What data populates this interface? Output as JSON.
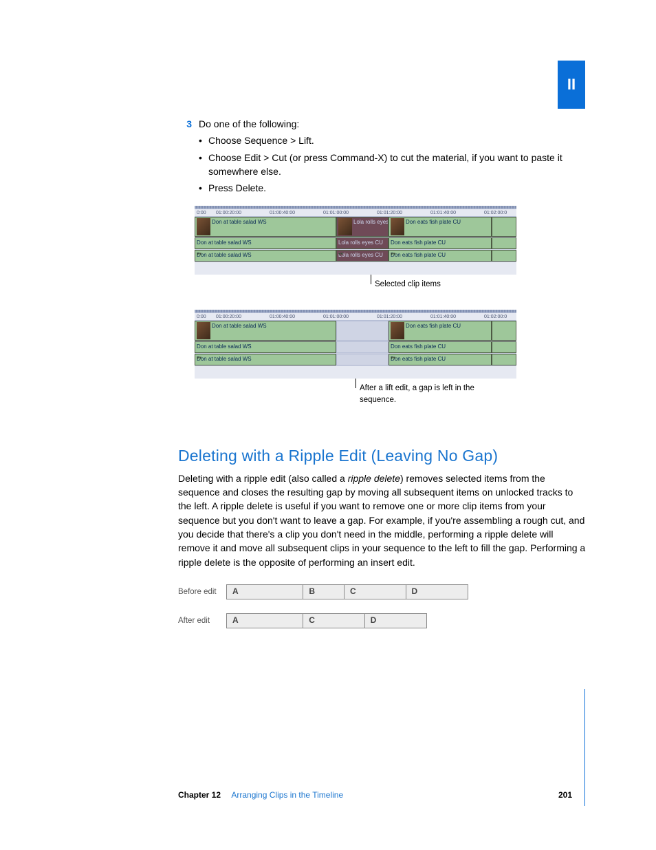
{
  "section_tab": "II",
  "step": {
    "number": "3",
    "intro": "Do one of the following:",
    "bullets": [
      "Choose Sequence > Lift.",
      "Choose Edit > Cut (or press Command-X) to cut the material, if you want to paste it somewhere else.",
      "Press Delete."
    ]
  },
  "timeline1": {
    "ticks": [
      "0:00",
      "01:00:20:00",
      "01:00:40:00",
      "01:01:00:00",
      "01:01:20:00",
      "01:01:40:00",
      "01:02:00:0"
    ],
    "clip_a": "Don at table salad WS",
    "clip_b": "Lola rolls eyes CU",
    "clip_c": "Don eats fish plate CU",
    "callout": "Selected clip items"
  },
  "timeline2": {
    "ticks": [
      "0:00",
      "01:00:20:00",
      "01:00:40:00",
      "01:01:00:00",
      "01:01:20:00",
      "01:01:40:00",
      "01:02:00:0"
    ],
    "clip_a": "Don at table salad WS",
    "clip_c": "Don eats fish plate CU",
    "callout": "After a lift edit, a gap is left in the sequence."
  },
  "heading": "Deleting with a Ripple Edit (Leaving No Gap)",
  "para_pre": "Deleting with a ripple edit (also called a ",
  "para_em": "ripple delete",
  "para_post": ") removes selected items from the sequence and closes the resulting gap by moving all subsequent items on unlocked tracks to the left. A ripple delete is useful if you want to remove one or more clip items from your sequence but you don't want to leave a gap. For example, if you're assembling a rough cut, and you decide that there's a clip you don't need in the middle, performing a ripple delete will remove it and move all subsequent clips in your sequence to the left to fill the gap. Performing a ripple delete is the opposite of performing an insert edit.",
  "ba": {
    "before_label": "Before edit",
    "after_label": "After edit",
    "before": [
      "A",
      "B",
      "C",
      "D"
    ],
    "after": [
      "A",
      "C",
      "D"
    ]
  },
  "footer": {
    "chapter": "Chapter 12",
    "title": "Arranging Clips in the Timeline",
    "page": "201"
  }
}
